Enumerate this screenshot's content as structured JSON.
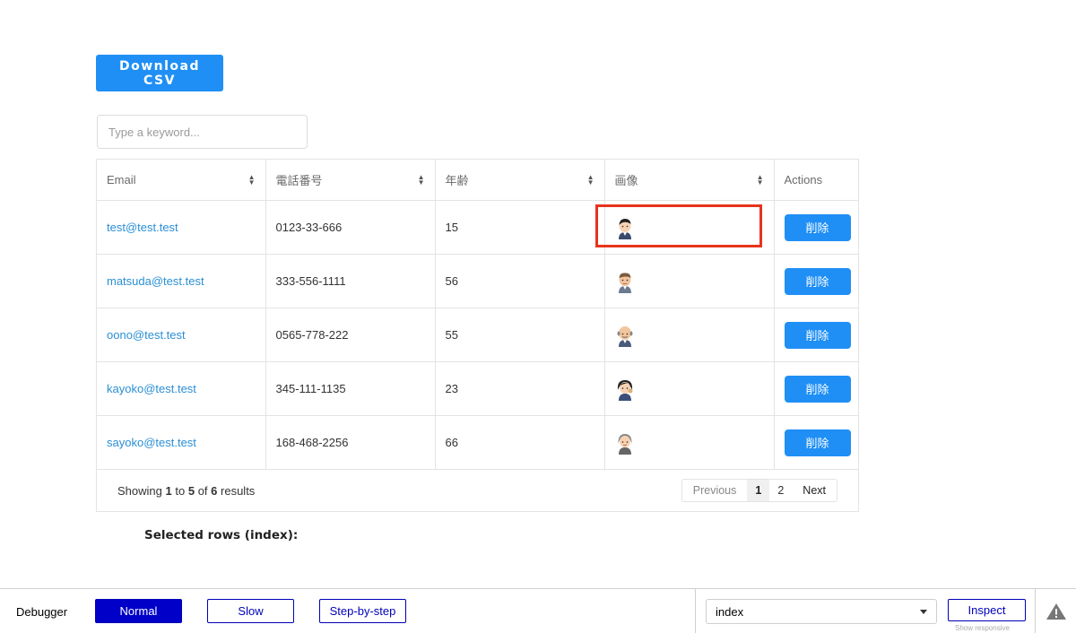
{
  "toolbar": {
    "download_label": "Download CSV"
  },
  "search": {
    "placeholder": "Type a keyword..."
  },
  "table": {
    "headers": [
      "Email",
      "電話番号",
      "年齢",
      "画像",
      "Actions"
    ],
    "delete_label": "削除",
    "rows": [
      {
        "email": "test@test.test",
        "phone": "0123-33-666",
        "age": "15",
        "avatar": "man-icon"
      },
      {
        "email": "matsuda@test.test",
        "phone": "333-556-1111",
        "age": "56",
        "avatar": "middle-aged-man-icon"
      },
      {
        "email": "oono@test.test",
        "phone": "0565-778-222",
        "age": "55",
        "avatar": "bald-man-icon"
      },
      {
        "email": "kayoko@test.test",
        "phone": "345-111-1135",
        "age": "23",
        "avatar": "woman-icon"
      },
      {
        "email": "sayoko@test.test",
        "phone": "168-468-2256",
        "age": "66",
        "avatar": "elderly-woman-icon"
      }
    ]
  },
  "footer": {
    "showing_prefix": "Showing",
    "from": "1",
    "to_word": "to",
    "to": "5",
    "of_word": "of",
    "total": "6",
    "suffix": "results"
  },
  "pagination": {
    "previous": "Previous",
    "pages": [
      "1",
      "2"
    ],
    "current": "1",
    "next": "Next"
  },
  "selected_rows_label": "Selected rows (index):",
  "debugger": {
    "label": "Debugger",
    "modes": [
      "Normal",
      "Slow",
      "Step-by-step"
    ],
    "active_mode": "Normal",
    "select_value": "index",
    "inspect_label": "Inspect",
    "show_responsive": "Show responsive"
  },
  "colors": {
    "primary": "#1f8ff5",
    "highlight": "#e8331c",
    "debug_blue": "#0000c8"
  }
}
